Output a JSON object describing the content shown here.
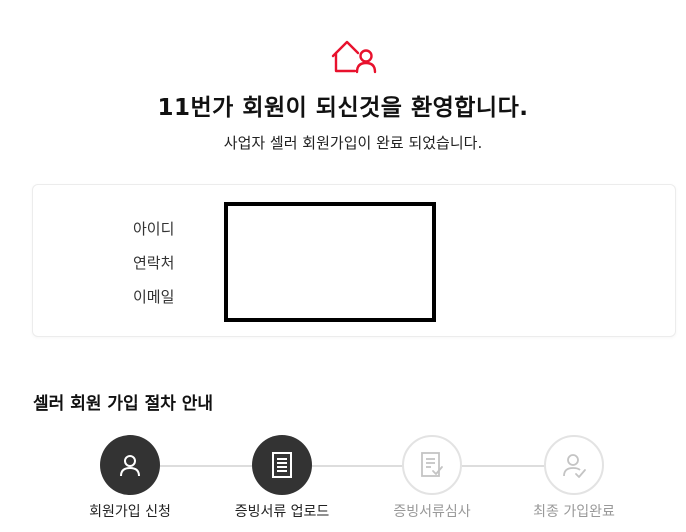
{
  "header": {
    "title": "11번가 회원이 되신것을 환영합니다.",
    "subtitle": "사업자 셀러 회원가입이 완료 되었습니다.",
    "icon": "home-user-icon",
    "accent_color": "#e8112d"
  },
  "account_info": {
    "labels": [
      "아이디",
      "연락처",
      "이메일"
    ]
  },
  "process": {
    "title": "셀러 회원 가입 절차 안내",
    "steps": [
      {
        "label": "회원가입 신청",
        "icon": "user-icon",
        "state": "active"
      },
      {
        "label": "증빙서류 업로드",
        "icon": "document-icon",
        "state": "active"
      },
      {
        "label": "증빙서류심사",
        "icon": "document-check-icon",
        "state": "inactive"
      },
      {
        "label": "최종 가입완료",
        "icon": "user-check-icon",
        "state": "inactive"
      }
    ]
  },
  "colors": {
    "step_active": "#333333",
    "step_inactive_border": "#e3e3e3",
    "step_inactive_text": "#999999"
  }
}
